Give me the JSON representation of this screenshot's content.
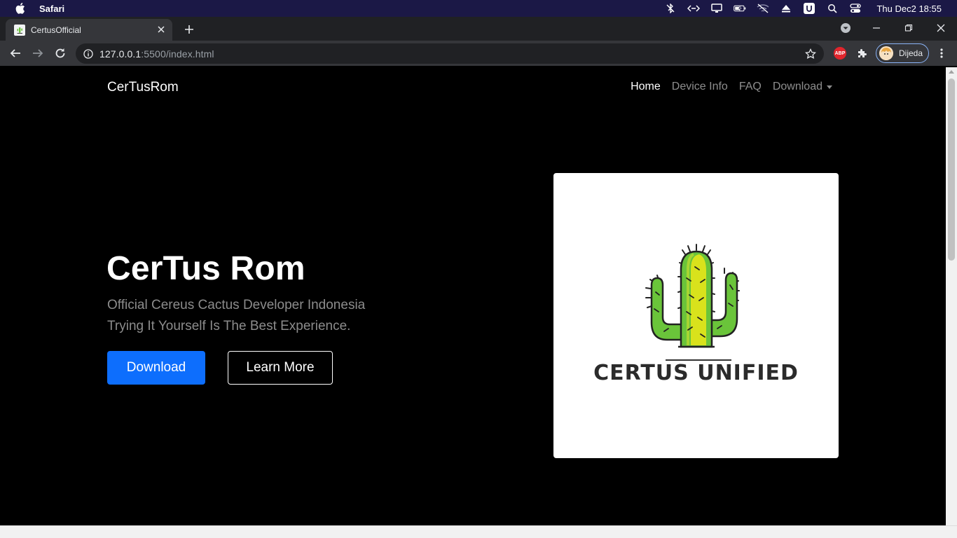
{
  "menubar": {
    "app_name": "Safari",
    "clock": "Thu Dec2 18:55",
    "status_icons": [
      "bluetooth-off-icon",
      "code-icon",
      "display-icon",
      "battery-icon",
      "wifi-off-icon",
      "eject-icon",
      "u-app-icon",
      "spotlight-icon",
      "control-center-icon"
    ]
  },
  "browser": {
    "tab_title": "CertusOfficial",
    "url_host": "127.0.0.1",
    "url_rest": ":5500/index.html",
    "profile_name": "Dijeda",
    "abp_label": "ABP"
  },
  "site": {
    "brand": "CerTusRom",
    "nav": [
      {
        "label": "Home",
        "active": true
      },
      {
        "label": "Device Info",
        "active": false
      },
      {
        "label": "FAQ",
        "active": false
      },
      {
        "label": "Download",
        "active": false,
        "dropdown": true
      }
    ],
    "hero": {
      "title": "CerTus Rom",
      "subtitle_line1": "Official Cereus Cactus Developer Indonesia",
      "subtitle_line2": "Trying It Yourself Is The Best Experience.",
      "primary_button": "Download",
      "secondary_button": "Learn More"
    },
    "logo": {
      "text": "CERTUS UNIFIED"
    }
  },
  "colors": {
    "menubar_bg": "#1b1846",
    "primary": "#0d6efd",
    "cactus_green": "#6ac43a",
    "cactus_yellow": "#d9e21c"
  }
}
